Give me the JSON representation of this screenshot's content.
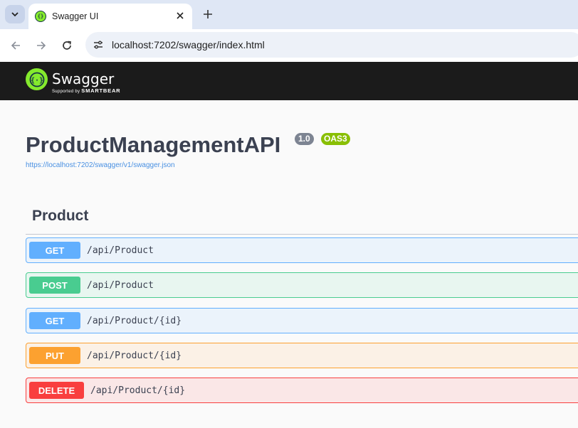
{
  "browser": {
    "tab_title": "Swagger UI",
    "url": "localhost:7202/swagger/index.html"
  },
  "swagger_header": {
    "logo_text": "Swagger",
    "logo_sub_prefix": "Supported by",
    "logo_sub_brand": "SMARTBEAR"
  },
  "info": {
    "title": "ProductManagementAPI",
    "version": "1.0",
    "oas_badge": "OAS3",
    "spec_url": "https://localhost:7202/swagger/v1/swagger.json"
  },
  "tag": {
    "name": "Product",
    "operations": [
      {
        "method": "GET",
        "path": "/api/Product"
      },
      {
        "method": "POST",
        "path": "/api/Product"
      },
      {
        "method": "GET",
        "path": "/api/Product/{id}"
      },
      {
        "method": "PUT",
        "path": "/api/Product/{id}"
      },
      {
        "method": "DELETE",
        "path": "/api/Product/{id}"
      }
    ]
  },
  "colors": {
    "get": "#61affe",
    "post": "#49cc90",
    "put": "#fca130",
    "delete": "#f93e3e",
    "swagger_green": "#85ea2d"
  }
}
